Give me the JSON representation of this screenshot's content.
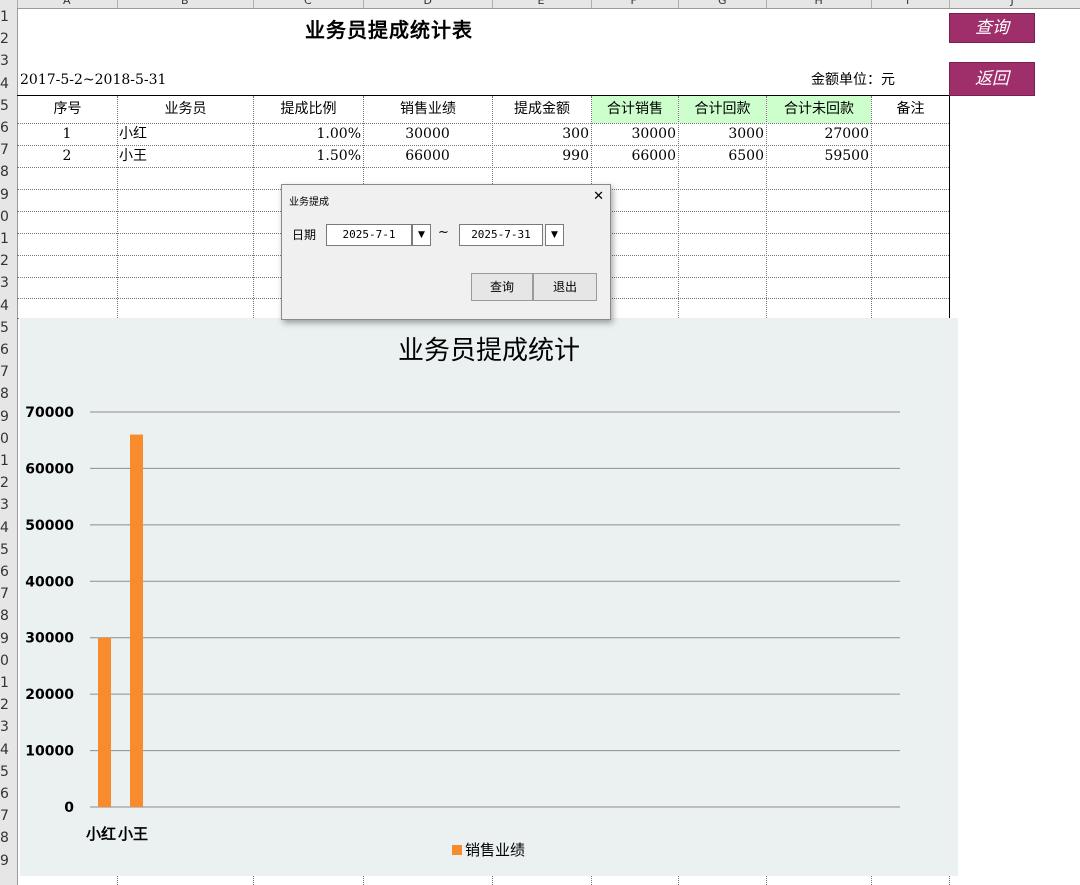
{
  "sheet": {
    "columns": [
      "A",
      "B",
      "C",
      "D",
      "E",
      "F",
      "G",
      "H",
      "I",
      "J"
    ],
    "rows": [
      "1",
      "2",
      "3",
      "4",
      "5",
      "6",
      "7",
      "8",
      "9",
      "0",
      "1",
      "2",
      "3",
      "4",
      "5",
      "6",
      "7",
      "8",
      "9",
      "0",
      "1",
      "2",
      "3",
      "4",
      "5",
      "6",
      "7",
      "8",
      "9",
      "0",
      "1",
      "2",
      "3",
      "4",
      "5",
      "6",
      "7",
      "8",
      "9"
    ],
    "title": "业务员提成统计表",
    "date_range": "2017-5-2~2018-5-31",
    "unit": "金额单位：元",
    "headers": [
      "序号",
      "业务员",
      "提成比例",
      "销售业绩",
      "提成金额",
      "合计销售",
      "合计回款",
      "合计未回款",
      "备注"
    ],
    "rows_data": [
      {
        "no": "1",
        "name": "小红",
        "rate": "1.00%",
        "sales": "30000",
        "commission": "300",
        "total_sales": "30000",
        "total_paid": "3000",
        "total_unpaid": "27000",
        "note": ""
      },
      {
        "no": "2",
        "name": "小王",
        "rate": "1.50%",
        "sales": "66000",
        "commission": "990",
        "total_sales": "66000",
        "total_paid": "6500",
        "total_unpaid": "59500",
        "note": ""
      }
    ],
    "buttons": {
      "query": "查询",
      "back": "返回"
    },
    "colors": {
      "button": "#9e2f6b",
      "header_highlight": "#ccffcc",
      "bar": "#f88c2c",
      "chart_bg": "#ebf1f1"
    }
  },
  "dialog": {
    "title": "业务提成",
    "date_label": "日期",
    "start_date": "2025-7-1",
    "end_date": "2025-7-31",
    "separator": "~",
    "query_label": "查询",
    "exit_label": "退出",
    "close_icon": "close-icon",
    "dropdown_icon": "triangle-down-icon"
  },
  "chart_data": {
    "type": "bar",
    "title": "业务员提成统计",
    "categories": [
      "小红",
      "小王"
    ],
    "series": [
      {
        "name": "销售业绩",
        "values": [
          30000,
          66000
        ]
      }
    ],
    "ylim": [
      0,
      70000
    ],
    "yticks": [
      0,
      10000,
      20000,
      30000,
      40000,
      50000,
      60000,
      70000
    ],
    "xlabel": "",
    "ylabel": "",
    "grid": true,
    "legend": "bottom"
  }
}
